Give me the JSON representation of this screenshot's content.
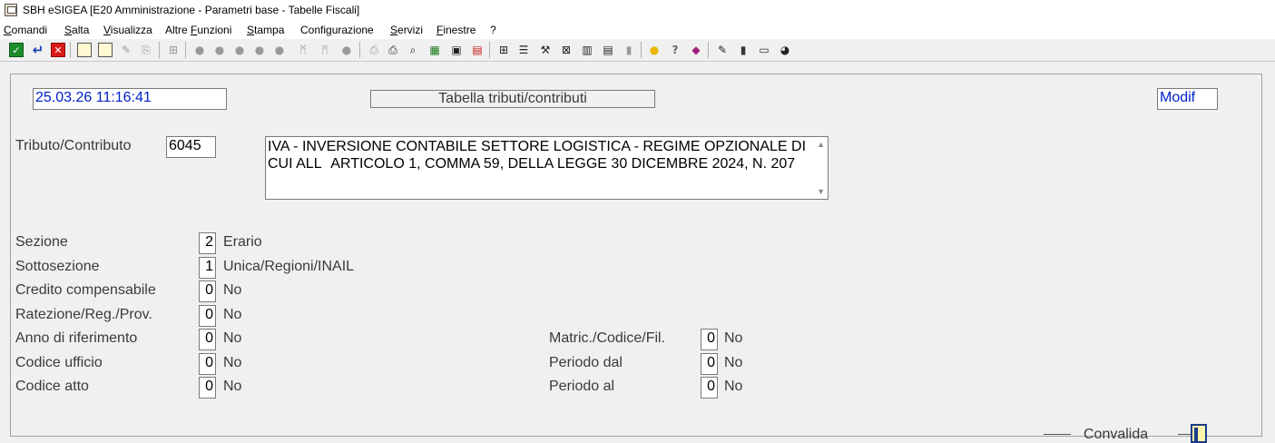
{
  "window": {
    "title": "SBH eSIGEA [E20 Amministrazione - Parametri base - Tabelle Fiscali]"
  },
  "menu": {
    "items": [
      {
        "pre": "",
        "u": "C",
        "post": "omandi"
      },
      {
        "pre": "",
        "u": "S",
        "post": "alta"
      },
      {
        "pre": "",
        "u": "V",
        "post": "isualizza"
      },
      {
        "pre": "Altre ",
        "u": "F",
        "post": "unzioni"
      },
      {
        "pre": "",
        "u": "S",
        "post": "tampa"
      },
      {
        "pre": "Confi",
        "u": "g",
        "post": "urazione"
      },
      {
        "pre": "",
        "u": "S",
        "post": "ervizi"
      },
      {
        "pre": "",
        "u": "F",
        "post": "inestre"
      },
      {
        "pre": "",
        "u": "",
        "post": "?"
      }
    ]
  },
  "toolbar": {
    "icons": [
      "confirm-icon",
      "enter-icon",
      "cancel-icon",
      "form-icon",
      "form-icon",
      "edit-icon",
      "copy-icon",
      "tree-icon",
      "f1-icon",
      "f2-icon",
      "f3-icon",
      "f4-icon",
      "f5-icon",
      "f6-icon",
      "f7-icon",
      "f8-icon",
      "print-icon",
      "printer-icon",
      "preview-icon",
      "excel-icon",
      "save-icon",
      "pdf-icon",
      "grid-icon",
      "list-icon",
      "tools-icon",
      "chart-icon",
      "table-icon",
      "report-icon",
      "bars-icon",
      "bulb-icon",
      "help-icon",
      "book-icon",
      "note-icon",
      "phone-icon",
      "calc-icon",
      "clock-icon"
    ]
  },
  "header": {
    "timestamp": "25.03.26 11:16:41",
    "table_title": "Tabella tributi/contributi",
    "mode": "Modif"
  },
  "tributo": {
    "label": "Tributo/Contributo",
    "code": "6045",
    "description": "IVA - INVERSIONE CONTABILE SETTORE LOGISTICA - REGIME OPZIONALE DI CUI ALLARTICOLO 1, COMMA 59, DELLA LEGGE 30 DICEMBRE 2024, N. 207"
  },
  "fields": {
    "sezione": {
      "label": "Sezione",
      "value": "2",
      "text": "Erario"
    },
    "sottosezione": {
      "label": "Sottosezione",
      "value": "1",
      "text": "Unica/Regioni/INAIL"
    },
    "credito": {
      "label": "Credito compensabile",
      "value": "0",
      "text": "No"
    },
    "rateazione": {
      "label": "Ratezione/Reg./Prov.",
      "value": "0",
      "text": "No"
    },
    "anno": {
      "label": "Anno di riferimento",
      "value": "0",
      "text": "No"
    },
    "ufficio": {
      "label": "Codice ufficio",
      "value": "0",
      "text": "No"
    },
    "atto": {
      "label": "Codice atto",
      "value": "0",
      "text": "No"
    },
    "matricola": {
      "label": "Matric./Codice/Fil.",
      "value": "0",
      "text": "No"
    },
    "periodo_dal": {
      "label": "Periodo dal",
      "value": "0",
      "text": "No"
    },
    "periodo_al": {
      "label": "Periodo al",
      "value": "0",
      "text": "No"
    }
  },
  "footer": {
    "convalida": "Convalida"
  }
}
